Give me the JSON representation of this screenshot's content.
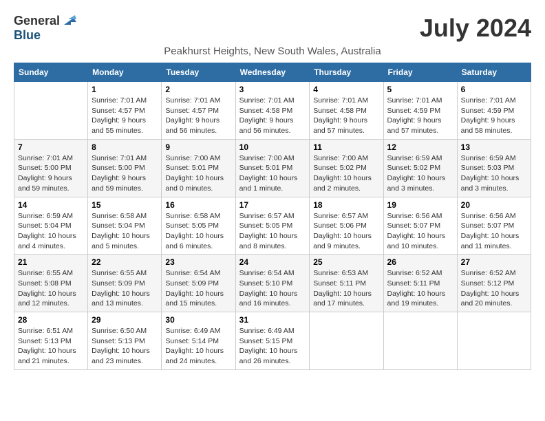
{
  "header": {
    "logo_general": "General",
    "logo_blue": "Blue",
    "month_year": "July 2024",
    "location": "Peakhurst Heights, New South Wales, Australia"
  },
  "days_of_week": [
    "Sunday",
    "Monday",
    "Tuesday",
    "Wednesday",
    "Thursday",
    "Friday",
    "Saturday"
  ],
  "weeks": [
    [
      {
        "day": "",
        "info": ""
      },
      {
        "day": "1",
        "info": "Sunrise: 7:01 AM\nSunset: 4:57 PM\nDaylight: 9 hours\nand 55 minutes."
      },
      {
        "day": "2",
        "info": "Sunrise: 7:01 AM\nSunset: 4:57 PM\nDaylight: 9 hours\nand 56 minutes."
      },
      {
        "day": "3",
        "info": "Sunrise: 7:01 AM\nSunset: 4:58 PM\nDaylight: 9 hours\nand 56 minutes."
      },
      {
        "day": "4",
        "info": "Sunrise: 7:01 AM\nSunset: 4:58 PM\nDaylight: 9 hours\nand 57 minutes."
      },
      {
        "day": "5",
        "info": "Sunrise: 7:01 AM\nSunset: 4:59 PM\nDaylight: 9 hours\nand 57 minutes."
      },
      {
        "day": "6",
        "info": "Sunrise: 7:01 AM\nSunset: 4:59 PM\nDaylight: 9 hours\nand 58 minutes."
      }
    ],
    [
      {
        "day": "7",
        "info": "Sunrise: 7:01 AM\nSunset: 5:00 PM\nDaylight: 9 hours\nand 59 minutes."
      },
      {
        "day": "8",
        "info": "Sunrise: 7:01 AM\nSunset: 5:00 PM\nDaylight: 9 hours\nand 59 minutes."
      },
      {
        "day": "9",
        "info": "Sunrise: 7:00 AM\nSunset: 5:01 PM\nDaylight: 10 hours\nand 0 minutes."
      },
      {
        "day": "10",
        "info": "Sunrise: 7:00 AM\nSunset: 5:01 PM\nDaylight: 10 hours\nand 1 minute."
      },
      {
        "day": "11",
        "info": "Sunrise: 7:00 AM\nSunset: 5:02 PM\nDaylight: 10 hours\nand 2 minutes."
      },
      {
        "day": "12",
        "info": "Sunrise: 6:59 AM\nSunset: 5:02 PM\nDaylight: 10 hours\nand 3 minutes."
      },
      {
        "day": "13",
        "info": "Sunrise: 6:59 AM\nSunset: 5:03 PM\nDaylight: 10 hours\nand 3 minutes."
      }
    ],
    [
      {
        "day": "14",
        "info": "Sunrise: 6:59 AM\nSunset: 5:04 PM\nDaylight: 10 hours\nand 4 minutes."
      },
      {
        "day": "15",
        "info": "Sunrise: 6:58 AM\nSunset: 5:04 PM\nDaylight: 10 hours\nand 5 minutes."
      },
      {
        "day": "16",
        "info": "Sunrise: 6:58 AM\nSunset: 5:05 PM\nDaylight: 10 hours\nand 6 minutes."
      },
      {
        "day": "17",
        "info": "Sunrise: 6:57 AM\nSunset: 5:05 PM\nDaylight: 10 hours\nand 8 minutes."
      },
      {
        "day": "18",
        "info": "Sunrise: 6:57 AM\nSunset: 5:06 PM\nDaylight: 10 hours\nand 9 minutes."
      },
      {
        "day": "19",
        "info": "Sunrise: 6:56 AM\nSunset: 5:07 PM\nDaylight: 10 hours\nand 10 minutes."
      },
      {
        "day": "20",
        "info": "Sunrise: 6:56 AM\nSunset: 5:07 PM\nDaylight: 10 hours\nand 11 minutes."
      }
    ],
    [
      {
        "day": "21",
        "info": "Sunrise: 6:55 AM\nSunset: 5:08 PM\nDaylight: 10 hours\nand 12 minutes."
      },
      {
        "day": "22",
        "info": "Sunrise: 6:55 AM\nSunset: 5:09 PM\nDaylight: 10 hours\nand 13 minutes."
      },
      {
        "day": "23",
        "info": "Sunrise: 6:54 AM\nSunset: 5:09 PM\nDaylight: 10 hours\nand 15 minutes."
      },
      {
        "day": "24",
        "info": "Sunrise: 6:54 AM\nSunset: 5:10 PM\nDaylight: 10 hours\nand 16 minutes."
      },
      {
        "day": "25",
        "info": "Sunrise: 6:53 AM\nSunset: 5:11 PM\nDaylight: 10 hours\nand 17 minutes."
      },
      {
        "day": "26",
        "info": "Sunrise: 6:52 AM\nSunset: 5:11 PM\nDaylight: 10 hours\nand 19 minutes."
      },
      {
        "day": "27",
        "info": "Sunrise: 6:52 AM\nSunset: 5:12 PM\nDaylight: 10 hours\nand 20 minutes."
      }
    ],
    [
      {
        "day": "28",
        "info": "Sunrise: 6:51 AM\nSunset: 5:13 PM\nDaylight: 10 hours\nand 21 minutes."
      },
      {
        "day": "29",
        "info": "Sunrise: 6:50 AM\nSunset: 5:13 PM\nDaylight: 10 hours\nand 23 minutes."
      },
      {
        "day": "30",
        "info": "Sunrise: 6:49 AM\nSunset: 5:14 PM\nDaylight: 10 hours\nand 24 minutes."
      },
      {
        "day": "31",
        "info": "Sunrise: 6:49 AM\nSunset: 5:15 PM\nDaylight: 10 hours\nand 26 minutes."
      },
      {
        "day": "",
        "info": ""
      },
      {
        "day": "",
        "info": ""
      },
      {
        "day": "",
        "info": ""
      }
    ]
  ]
}
